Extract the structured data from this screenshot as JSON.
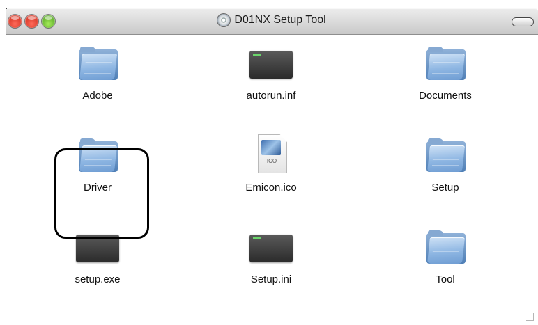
{
  "window": {
    "title": "D01NX Setup Tool"
  },
  "items": [
    {
      "name": "Adobe",
      "kind": "folder"
    },
    {
      "name": "autorun.inf",
      "kind": "exe"
    },
    {
      "name": "Documents",
      "kind": "folder"
    },
    {
      "name": "Driver",
      "kind": "folder",
      "highlighted": true
    },
    {
      "name": "Emicon.ico",
      "kind": "ico",
      "ext_label": "ICO"
    },
    {
      "name": "Setup",
      "kind": "folder"
    },
    {
      "name": "setup.exe",
      "kind": "exe"
    },
    {
      "name": "Setup.ini",
      "kind": "exe"
    },
    {
      "name": "Tool",
      "kind": "folder"
    }
  ],
  "colors": {
    "close": "#c31c0c",
    "minimize": "#c31c0c",
    "zoom": "#3b8e14",
    "highlight_border": "#000000"
  }
}
